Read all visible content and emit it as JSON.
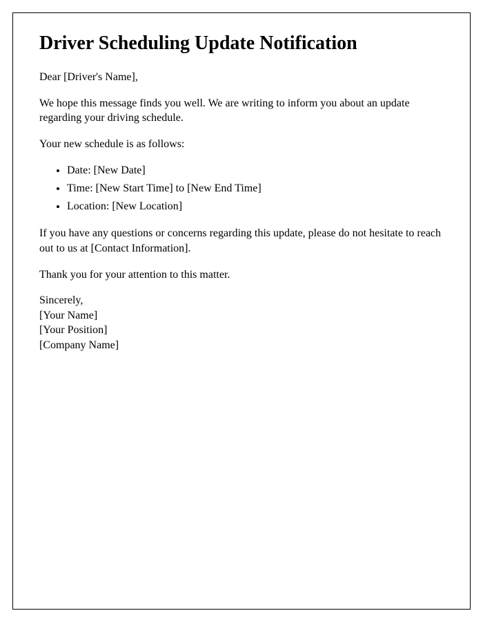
{
  "title": "Driver Scheduling Update Notification",
  "greeting": "Dear [Driver's Name],",
  "intro": "We hope this message finds you well. We are writing to inform you about an update regarding your driving schedule.",
  "schedule_intro": "Your new schedule is as follows:",
  "schedule": {
    "date": "Date: [New Date]",
    "time": "Time: [New Start Time] to [New End Time]",
    "location": "Location: [New Location]"
  },
  "contact_note": "If you have any questions or concerns regarding this update, please do not hesitate to reach out to us at [Contact Information].",
  "thanks": "Thank you for your attention to this matter.",
  "signoff": {
    "closing": "Sincerely,",
    "name": "[Your Name]",
    "position": "[Your Position]",
    "company": "[Company Name]"
  }
}
